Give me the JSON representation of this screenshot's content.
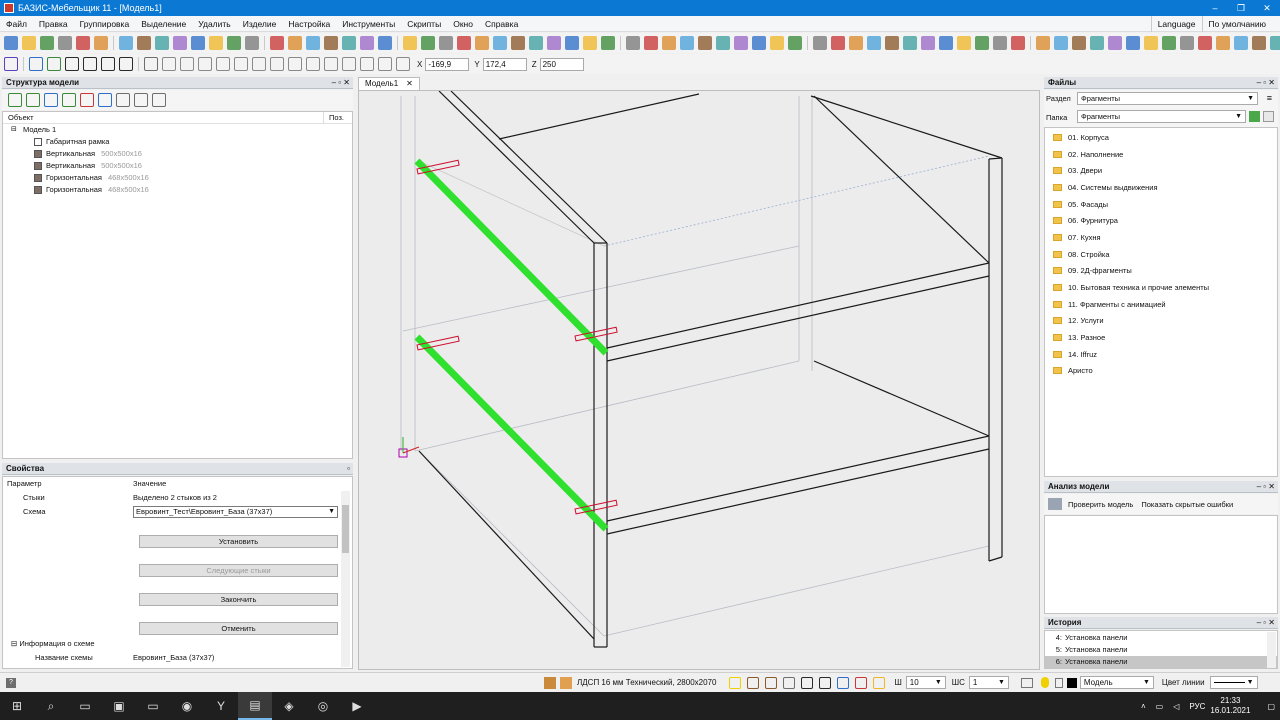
{
  "window": {
    "title": "БАЗИС-Мебельщик 11 - [Модель1]",
    "min": "–",
    "max": "❐",
    "close": "✕"
  },
  "menu": {
    "items": [
      "Файл",
      "Правка",
      "Группировка",
      "Выделение",
      "Удалить",
      "Изделие",
      "Настройка",
      "Инструменты",
      "Скрипты",
      "Окно",
      "Справка"
    ],
    "language": "Language",
    "default": "По умолчанию"
  },
  "coords": {
    "x_label": "X",
    "x": "-169,9",
    "y_label": "Y",
    "y": "172,4",
    "z_label": "Z",
    "z": "250"
  },
  "structure": {
    "title": "Структура модели",
    "col_object": "Объект",
    "col_pos": "Поз.",
    "root": "Модель 1",
    "nodes": [
      {
        "name": "Габаритная рамка",
        "size": ""
      },
      {
        "name": "Вертикальная",
        "size": "500x500x16"
      },
      {
        "name": "Вертикальная",
        "size": "500x500x16"
      },
      {
        "name": "Горизонтальная",
        "size": "468x500x16"
      },
      {
        "name": "Горизонтальная",
        "size": "468x500x16"
      }
    ]
  },
  "properties": {
    "title": "Свойства",
    "col_param": "Параметр",
    "col_value": "Значение",
    "joints_label": "Стыки",
    "joints_value": "Выделено 2 стыков из 2",
    "scheme_label": "Схема",
    "scheme_value": "Евровинт_Тест\\Евровинт_База (37x37)",
    "btn_install": "Установить",
    "btn_next": "Следующие стыки",
    "btn_finish": "Закончить",
    "btn_cancel": "Отменить",
    "info_label": "Информация о схеме",
    "name_label": "Название схемы",
    "name_value": "Евровинт_База (37x37)"
  },
  "viewport": {
    "tab": "Модель1",
    "tab_close": "✕"
  },
  "files": {
    "title": "Файлы",
    "section_label": "Раздел",
    "section_value": "Фрагменты",
    "folder_label": "Папка",
    "folder_value": "Фрагменты",
    "folders": [
      "01. Корпуса",
      "02. Наполнение",
      "03. Двери",
      "04. Системы выдвижения",
      "05. Фасады",
      "06. Фурнитура",
      "07. Кухня",
      "08. Стройка",
      "09. 2Д-фрагменты",
      "10. Бытовая техника и прочие элементы",
      "11. Фрагменты с анимацией",
      "12. Услуги",
      "13. Разное",
      "14. Iffruz",
      "Аристо"
    ]
  },
  "analysis": {
    "title": "Анализ модели",
    "check": "Проверить модель",
    "hidden": "Показать скрытые ошибки"
  },
  "history": {
    "title": "История",
    "items": [
      {
        "n": "4:",
        "text": "Установка панели"
      },
      {
        "n": "5:",
        "text": "Установка панели"
      },
      {
        "n": "6:",
        "text": "Установка панели"
      }
    ]
  },
  "status": {
    "material": "ЛДСП 16 мм Технический, 2800x2070",
    "sh_label": "Ш",
    "sh_value": "10",
    "shc_label": "ШС",
    "shc_value": "1",
    "layer": "Модель",
    "line_color_label": "Цвет линии"
  },
  "taskbar": {
    "lang": "РУС",
    "time": "21:33",
    "date": "16.01.2021"
  },
  "colors": {
    "accent": "#0b78d4",
    "edge_highlight": "#2fe02f",
    "fastener": "#d01030"
  }
}
